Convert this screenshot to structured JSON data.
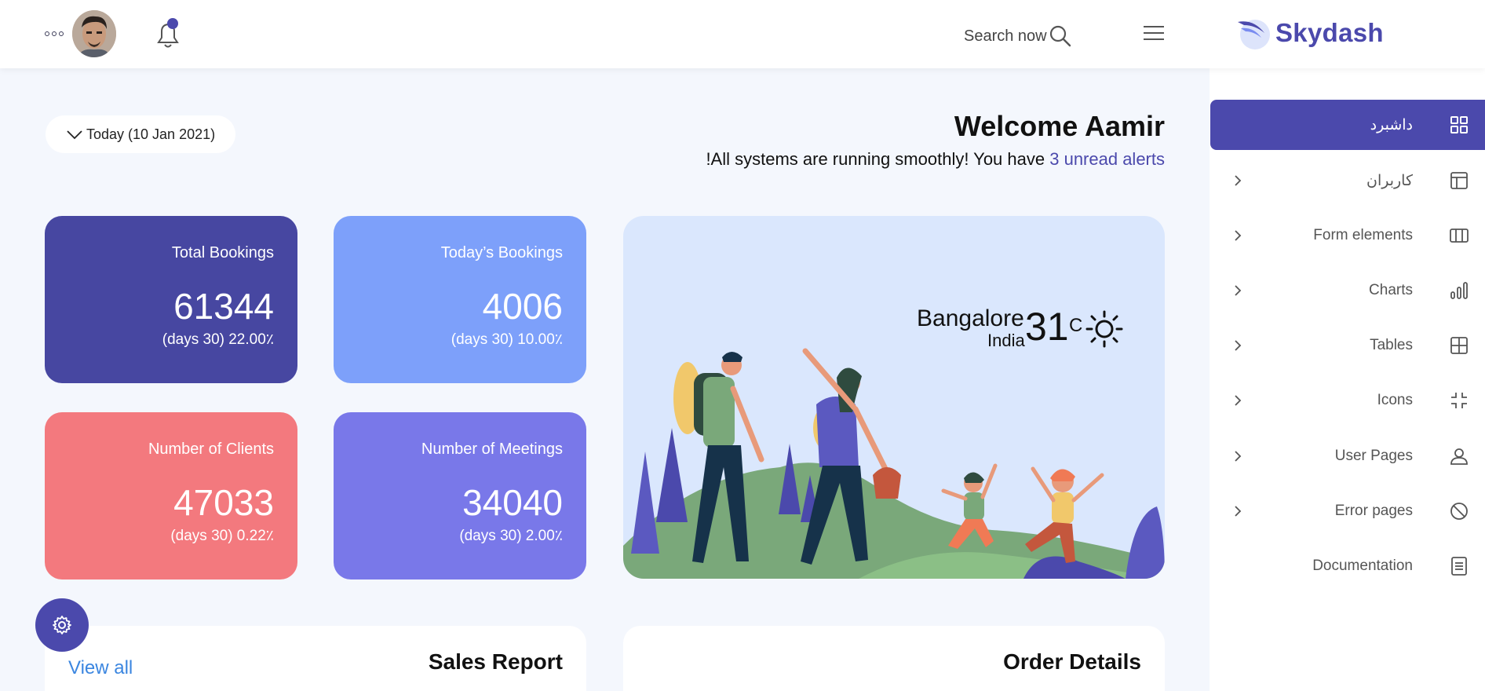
{
  "header": {
    "search_label": "Search now",
    "brand": "Skydash"
  },
  "sidebar": {
    "items": [
      {
        "label": "داشبرد",
        "icon": "grid-icon",
        "active": true,
        "chevron": false
      },
      {
        "label": "کاربران",
        "icon": "layout-icon",
        "active": false,
        "chevron": true
      },
      {
        "label": "Form elements",
        "icon": "columns-icon",
        "active": false,
        "chevron": true
      },
      {
        "label": "Charts",
        "icon": "bar-chart-icon",
        "active": false,
        "chevron": true
      },
      {
        "label": "Tables",
        "icon": "table-icon",
        "active": false,
        "chevron": true
      },
      {
        "label": "Icons",
        "icon": "minimize-icon",
        "active": false,
        "chevron": true
      },
      {
        "label": "User Pages",
        "icon": "user-icon",
        "active": false,
        "chevron": true
      },
      {
        "label": "Error pages",
        "icon": "ban-icon",
        "active": false,
        "chevron": true
      },
      {
        "label": "Documentation",
        "icon": "document-icon",
        "active": false,
        "chevron": false
      }
    ]
  },
  "main": {
    "date_filter": "Today (10 Jan 2021)",
    "welcome": "Welcome Aamir",
    "status_prefix": "!All systems are running smoothly! You have ",
    "status_link": "3 unread alerts",
    "stats": [
      {
        "title": "Total Bookings",
        "value": "61344",
        "sub": "(days 30) 22.00٪",
        "color": "#4747a1"
      },
      {
        "title": "Today’s Bookings",
        "value": "4006",
        "sub": "(days 30) 10.00٪",
        "color": "#7da0fa"
      },
      {
        "title": "Number of Clients",
        "value": "47033",
        "sub": "(days 30) 0.22٪",
        "color": "#f3797e"
      },
      {
        "title": "Number of Meetings",
        "value": "34040",
        "sub": "(days 30) 2.00٪",
        "color": "#7978e9"
      }
    ],
    "weather": {
      "city": "Bangalore",
      "country": "India",
      "temperature": "31",
      "unit": "C",
      "icon": "sun-icon"
    },
    "sales_report": {
      "title": "Sales Report",
      "view_all": "View all"
    },
    "order_details": {
      "title": "Order Details"
    }
  },
  "colors": {
    "accent": "#4b49ac",
    "link": "#3b86e0",
    "background": "#f4f7fd"
  }
}
